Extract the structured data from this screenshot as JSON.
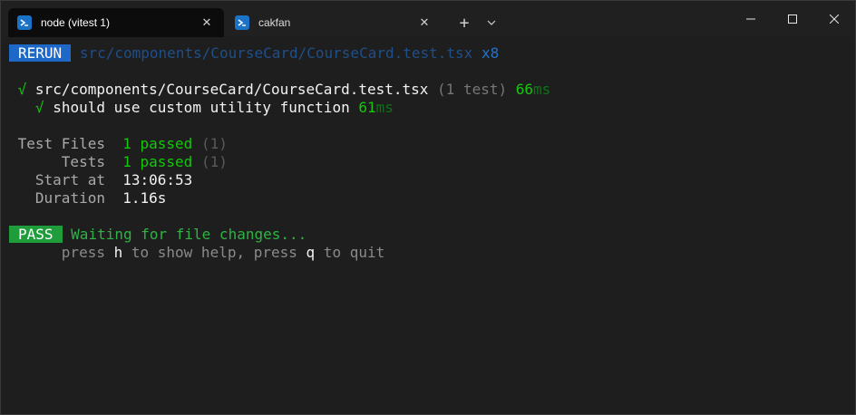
{
  "tabs": [
    {
      "title": "node (vitest 1)",
      "icon": "powershell-icon"
    },
    {
      "title": "cakfan",
      "icon": "powershell-icon"
    }
  ],
  "toolbar": {
    "new_tab": "+",
    "dropdown": "⌄"
  },
  "window_controls": {
    "minimize": "—",
    "maximize": "☐",
    "close": "✕"
  },
  "terminal": {
    "rerun": {
      "badge": "RERUN",
      "path": "src/components/CourseCard/CourseCard.test.tsx",
      "count": "x8"
    },
    "file_result": {
      "check": "√",
      "path": "src/components/CourseCard/CourseCard.test.tsx",
      "count": "(1 test)",
      "time_value": "66",
      "time_unit": "ms"
    },
    "test_result": {
      "check": "√",
      "name": "should use custom utility function",
      "time_value": "61",
      "time_unit": "ms"
    },
    "summary": {
      "test_files_label": "Test Files",
      "test_files_value": "1 passed",
      "test_files_total": "(1)",
      "tests_label": "Tests",
      "tests_value": "1 passed",
      "tests_total": "(1)",
      "start_label": "Start at",
      "start_value": "13:06:53",
      "duration_label": "Duration",
      "duration_value": "1.16s"
    },
    "pass": {
      "badge": "PASS",
      "message": "Waiting for file changes...",
      "help_prefix": "press ",
      "help_key1": "h",
      "help_mid": " to show help, press ",
      "help_key2": "q",
      "help_suffix": " to quit"
    }
  },
  "colors": {
    "background": "#1e1e1e",
    "rerun_badge": "#1e68c8",
    "pass_badge": "#1f9d3a",
    "green": "#16c60c",
    "blue": "#2472c8"
  }
}
